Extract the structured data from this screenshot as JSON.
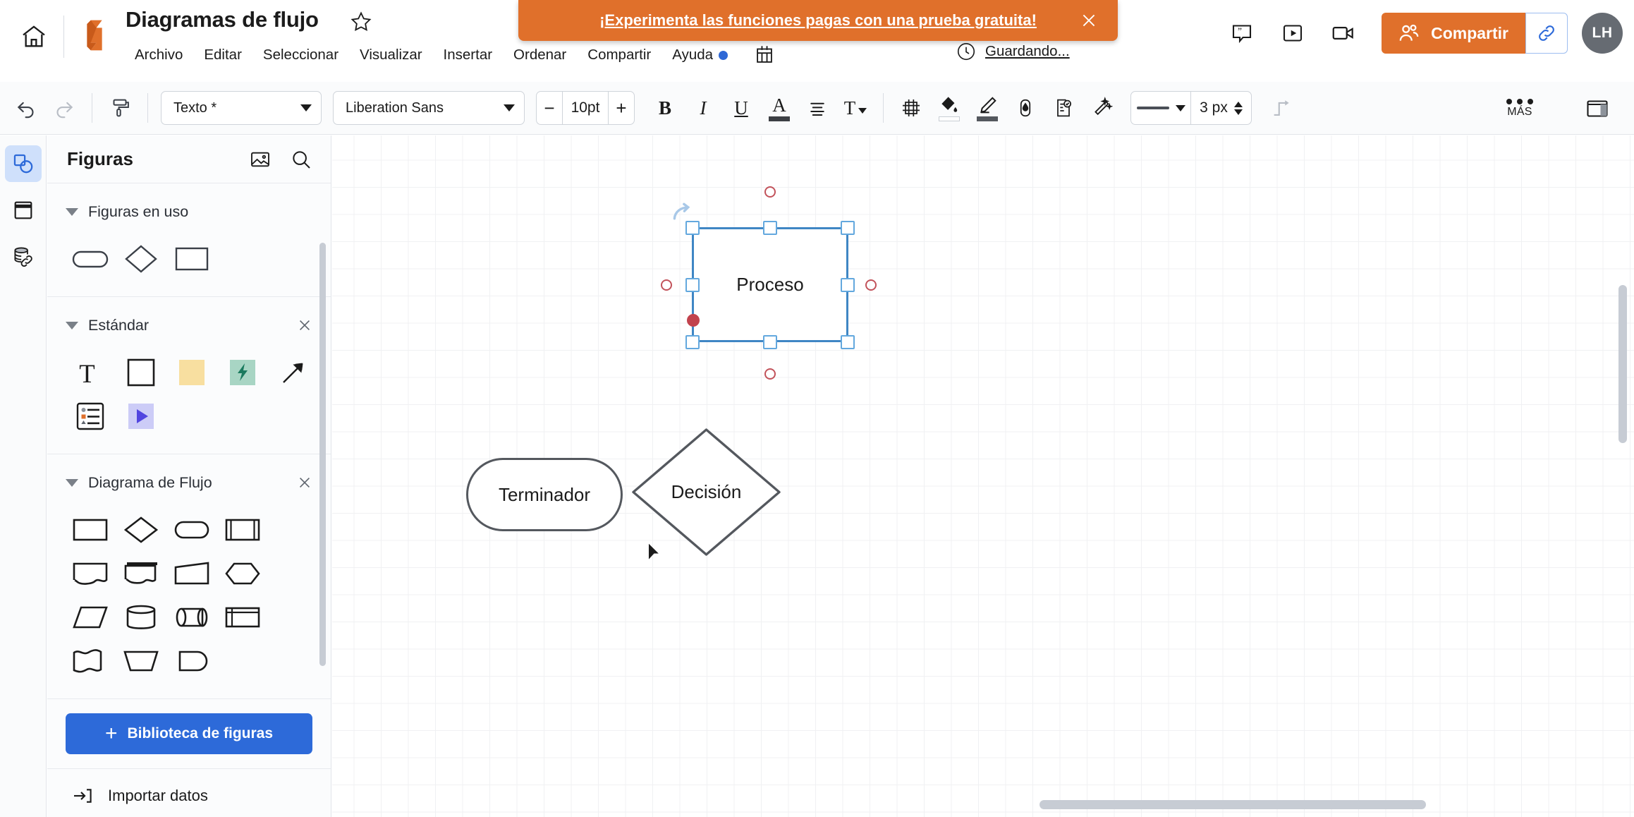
{
  "header": {
    "home_icon": "home-icon",
    "logo": "lucid-logo",
    "doc_title": "Diagramas de flujo",
    "star_icon": "star-outline-icon",
    "menu_items": [
      {
        "label": "Archivo"
      },
      {
        "label": "Editar"
      },
      {
        "label": "Seleccionar"
      },
      {
        "label": "Visualizar"
      },
      {
        "label": "Insertar"
      },
      {
        "label": "Ordenar"
      },
      {
        "label": "Compartir"
      },
      {
        "label": "Ayuda"
      }
    ],
    "help_has_badge": true,
    "grid_icon": "layers-grid-icon",
    "saving_status": "Guardando...",
    "saving_icon": "clock-icon",
    "right_icons": [
      "comment-icon",
      "present-icon",
      "video-icon"
    ],
    "share_label": "Compartir",
    "share_icon": "people-icon",
    "link_icon": "link-icon",
    "avatar_initials": "LH",
    "accent_orange": "#e0702b",
    "avatar_bg": "#666b72"
  },
  "banner": {
    "text": "¡Experimenta las funciones pagas con una prueba gratuita!",
    "close_icon": "close-icon",
    "bg": "#e0702b"
  },
  "toolbar": {
    "undo_icon": "undo-icon",
    "redo_icon": "redo-icon",
    "format_painter_icon": "paint-roller-icon",
    "style_select": "Texto *",
    "font_select": "Liberation Sans",
    "font_size": "10pt",
    "font_size_minus": "−",
    "font_size_plus": "+",
    "bold": "B",
    "italic": "I",
    "underline": "U",
    "text_color": "A",
    "text_color_swatch": "#3c3f44",
    "align_icon": "align-icon",
    "text_options": "T",
    "shape_icons": [
      "position-crop-icon",
      "fill-bucket-icon",
      "line-color-icon",
      "opacity-drop-icon",
      "shape-options-icon",
      "magic-wand-icon"
    ],
    "fill_swatch": "#ffffff",
    "line_swatch": "#54585e",
    "line_style_preview": "solid-line",
    "line_width": "3 px",
    "connector_icon": "elbow-connector-icon",
    "more_label": "MÁS",
    "more_icon": "three-dots-icon",
    "panel_toggle_icon": "right-panel-toggle-icon"
  },
  "rail": {
    "items": [
      {
        "name": "shapes",
        "icon": "shapes-icon",
        "active": true
      },
      {
        "name": "templates",
        "icon": "template-icon",
        "active": false
      },
      {
        "name": "data",
        "icon": "database-link-icon",
        "active": false
      }
    ]
  },
  "panel": {
    "title": "Figuras",
    "image_icon": "image-icon",
    "search_icon": "search-icon",
    "sections": [
      {
        "title": "Figuras en uso",
        "closable": false,
        "shapes": [
          "stadium",
          "diamond",
          "rectangle"
        ]
      },
      {
        "title": "Estándar",
        "closable": true,
        "close_icon": "close-icon",
        "shapes": [
          "text-T",
          "rectangle",
          "sticky-note",
          "lightning-action",
          "arrow",
          "legend-list",
          "play-triangle"
        ]
      },
      {
        "title": "Diagrama de Flujo",
        "closable": true,
        "close_icon": "close-icon",
        "shapes": [
          "process-rectangle",
          "decision-diamond",
          "terminator-stadium",
          "predefined-process",
          "document",
          "multi-document",
          "manual-input",
          "preparation-hexagon",
          "data-parallelogram",
          "database-cylinder",
          "direct-access-storage",
          "internal-storage",
          "multi-wave-document",
          "manual-operation",
          "display"
        ]
      }
    ],
    "library_button": "Biblioteca de figuras",
    "library_plus": "+",
    "library_bg": "#2d6ad9",
    "import_label": "Importar datos",
    "import_icon": "import-arrow-icon"
  },
  "canvas": {
    "grid_visible": true,
    "shapes": [
      {
        "id": "terminador",
        "type": "terminator",
        "label": "Terminador",
        "selected": false
      },
      {
        "id": "decision",
        "type": "decision",
        "label": "Decisión",
        "selected": false
      },
      {
        "id": "proceso",
        "type": "process",
        "label": "Proceso",
        "selected": true
      }
    ],
    "selection": {
      "handle_count": 8,
      "connection_points": 4,
      "active_connection_point": "left",
      "rotate_handle": "rotate-icon",
      "handle_border": "#63a8de",
      "frame_color": "#3f86c4",
      "connector_color": "#c2525a"
    },
    "cursor": "arrow-cursor",
    "h_scrollbar": "horizontal-scrollbar",
    "v_scrollbar": "vertical-scrollbar"
  }
}
